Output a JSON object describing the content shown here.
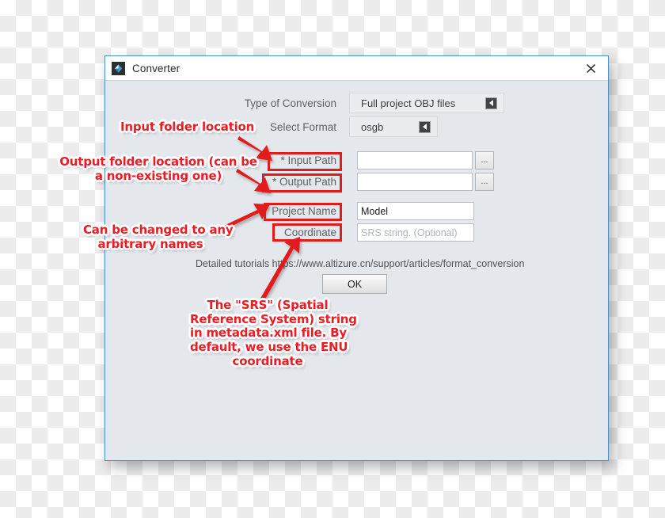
{
  "window": {
    "title": "Converter",
    "app_icon": "converter-app-icon",
    "close_icon": "close-icon",
    "border_color": "#4a90c2",
    "body_color": "#e4e8ec"
  },
  "form": {
    "type_of_conversion": {
      "label": "Type of Conversion",
      "value": "Full project OBJ files",
      "arrow_icon": "triangle-left-icon"
    },
    "select_format": {
      "label": "Select Format",
      "value": "osgb",
      "arrow_icon": "triangle-left-icon"
    },
    "input_path": {
      "label": "* Input Path",
      "value": "",
      "placeholder": "",
      "browse_label": "..."
    },
    "output_path": {
      "label": "* Output Path",
      "value": "",
      "placeholder": "",
      "browse_label": "..."
    },
    "project_name": {
      "label": "Project Name",
      "value": "Model",
      "placeholder": ""
    },
    "coordinate": {
      "label": "Coordinate",
      "value": "",
      "placeholder": "SRS string. (Optional)"
    },
    "tutorial_text": "Detailed tutorials https://www.altizure.cn/support/articles/format_conversion",
    "ok_label": "OK"
  },
  "annotations": {
    "accent_color": "#ed1c24",
    "notes": [
      {
        "id": "input-folder-note",
        "text": "Input folder location"
      },
      {
        "id": "output-folder-note",
        "text": "Output folder location (can be\na non-existing one)"
      },
      {
        "id": "arbitrary-names-note",
        "text": "Can be changed to any\narbitrary names"
      },
      {
        "id": "srs-note",
        "text": "The \"SRS\" (Spatial\nReference System) string\nin metadata.xml file. By\ndefault, we use the ENU\ncoordinate"
      }
    ]
  }
}
